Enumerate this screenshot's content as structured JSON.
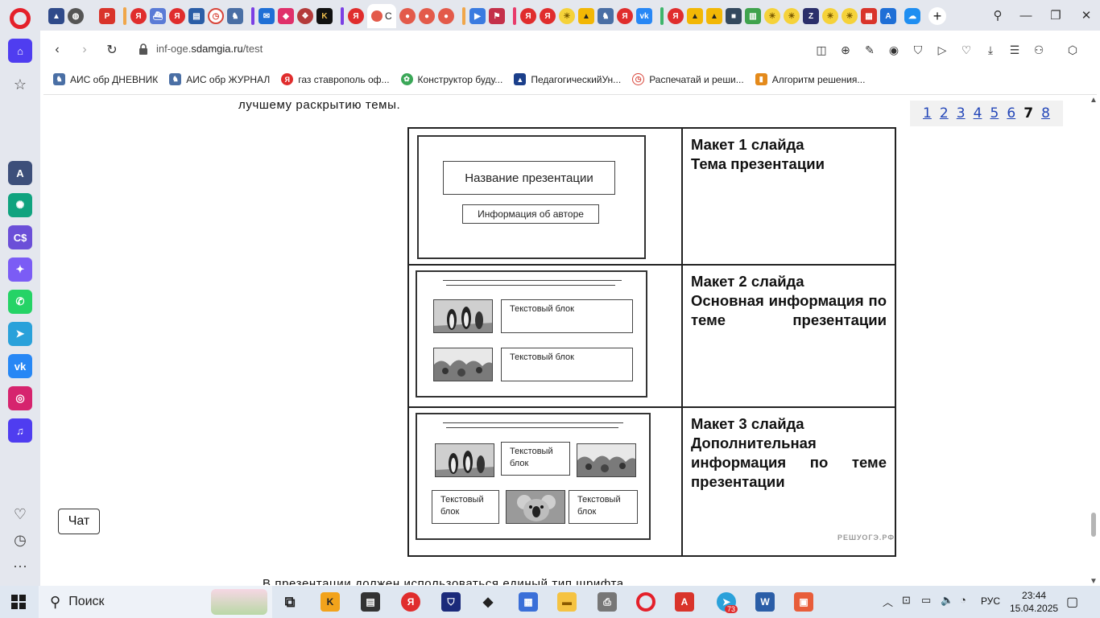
{
  "browser": {
    "tab_active_label": "С",
    "url_prefix": "inf-oge.",
    "url_host": "sdamgia.ru",
    "url_path": "/test"
  },
  "bookmarks": [
    {
      "label": "АИС обр ДНЕВНИК",
      "color": "#4a6fa5"
    },
    {
      "label": "АИС обр ЖУРНАЛ",
      "color": "#4a6fa5"
    },
    {
      "label": "газ ставрополь оф...",
      "color": "#e02d2d"
    },
    {
      "label": "Конструктор буду...",
      "color": "#3aa757"
    },
    {
      "label": "ПедагогическийУн...",
      "color": "#1b3f8b"
    },
    {
      "label": "Распечатай и реши...",
      "color": "#d8453a"
    },
    {
      "label": "Алгоритм решения...",
      "color": "#e48a1b"
    }
  ],
  "page": {
    "intro_text": "лучшему раскрытию темы.",
    "bottom_text": "В презентации должен использоваться единый тип шрифта.",
    "pager": [
      "1",
      "2",
      "3",
      "4",
      "5",
      "6",
      "7",
      "8"
    ],
    "pager_current": "7"
  },
  "layouts": [
    {
      "title": "Макет 1 слайда",
      "subtitle": "Тема презентации"
    },
    {
      "title": "Макет 2 слайда",
      "subtitle": "Основная информация по теме презентации"
    },
    {
      "title": "Макет 3 слайда",
      "subtitle": "Дополнительная информация по теме презентации"
    }
  ],
  "slide1": {
    "title_box": "Название презентации",
    "author_box": "Информация об авторе"
  },
  "slide_text_block": "Текстовый блок",
  "slide_text_block_line1": "Текстовый",
  "slide_text_block_line2": "блок",
  "watermark": "РЕШУОГЭ.РФ",
  "chat_label": "Чат",
  "taskbar": {
    "search_label": "Поиск",
    "lang": "РУС",
    "time": "23:44",
    "date": "15.04.2025",
    "telegram_badge": "73"
  }
}
